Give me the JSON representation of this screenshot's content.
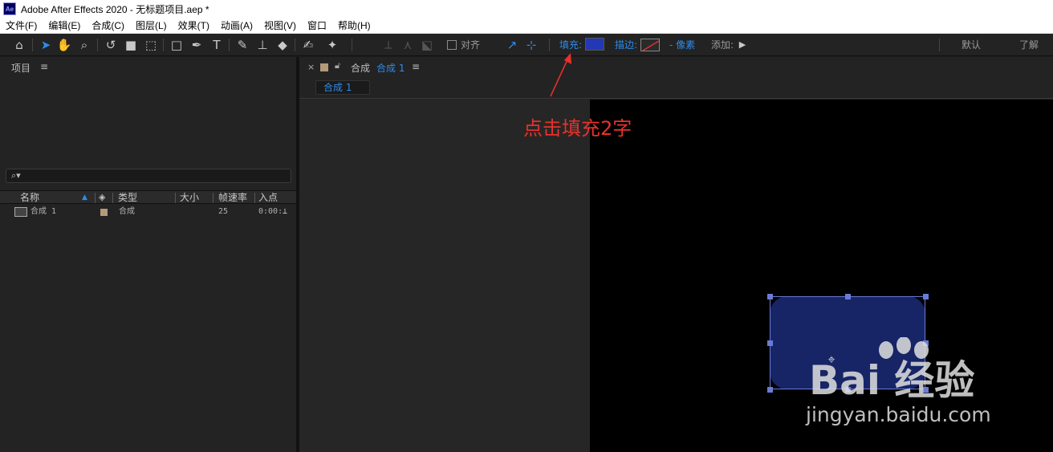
{
  "window": {
    "app_icon_text": "Ae",
    "title": "Adobe After Effects 2020 - 无标题项目.aep *"
  },
  "menu": [
    "文件(F)",
    "编辑(E)",
    "合成(C)",
    "图层(L)",
    "效果(T)",
    "动画(A)",
    "视图(V)",
    "窗口",
    "帮助(H)"
  ],
  "toolbar": {
    "tools": [
      "home-icon",
      "selection-icon",
      "hand-icon",
      "zoom-icon",
      "rotate-icon",
      "camera-icon",
      "pan-behind-icon",
      "rectangle-icon",
      "pen-icon",
      "type-icon",
      "brush-icon",
      "clone-stamp-icon",
      "eraser-icon",
      "roto-brush-icon",
      "puppet-pin-icon"
    ],
    "align_label": "对齐",
    "fill_label": "填充:",
    "fill_color": "#2238b5",
    "stroke_label": "描边:",
    "stroke_width_label": "- 像素",
    "add_label": "添加:",
    "workspace_default": "默认",
    "workspace_learn": "了解"
  },
  "project_panel": {
    "title": "项目",
    "search_placeholder": "",
    "columns": [
      "名称",
      "类型",
      "大小",
      "帧速率",
      "入点"
    ],
    "rows": [
      {
        "name": "合成 1",
        "type": "合成",
        "size": "",
        "frame_rate": "25",
        "in_point": "0:00:"
      }
    ]
  },
  "composition_panel": {
    "tab_label": "合成",
    "tab_active": "合成 1",
    "breadcrumb": "合成 1"
  },
  "annotation": {
    "text": "点击填充2字",
    "color": "#e8312a"
  },
  "watermark": {
    "main": "Bai 经验",
    "sub": "jingyan.baidu.com"
  }
}
